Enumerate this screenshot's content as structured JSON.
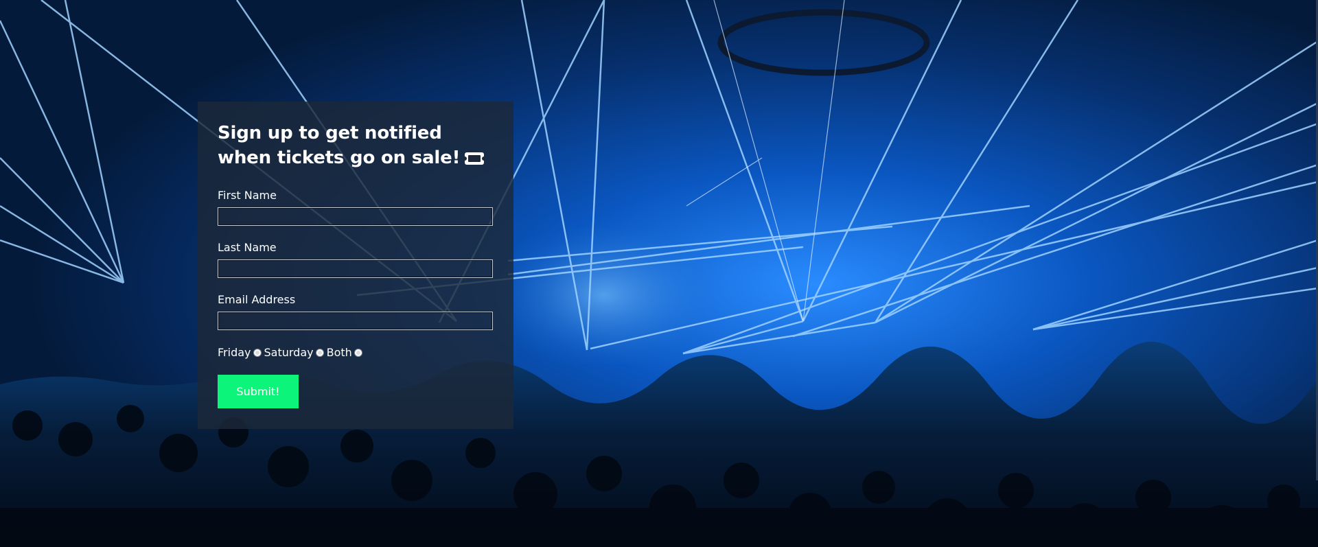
{
  "form": {
    "title": "Sign up to get notified when tickets go on sale!",
    "title_icon": "ticket-icon",
    "first_name_label": "First Name",
    "first_name_value": "",
    "last_name_label": "Last Name",
    "last_name_value": "",
    "email_label": "Email Address",
    "email_value": "",
    "options": [
      "Friday",
      "Saturday",
      "Both"
    ],
    "submit_label": "Submit!"
  },
  "colors": {
    "accent": "#0cf57a",
    "panel": "#1c2838",
    "laser": "#4aa8ff"
  }
}
